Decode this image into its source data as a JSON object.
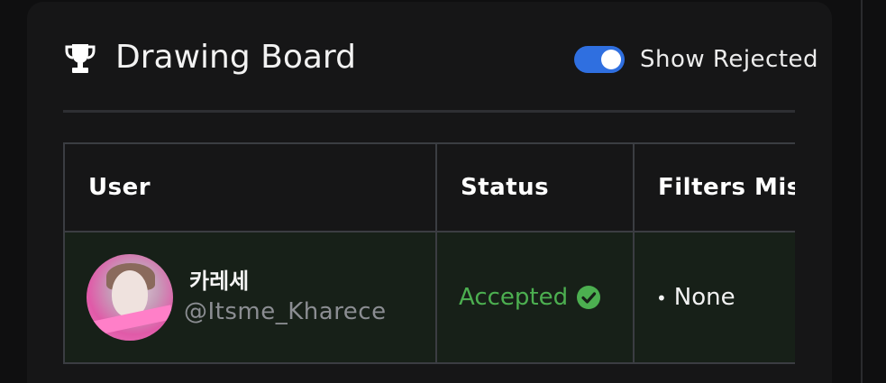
{
  "board": {
    "title": "Drawing Board",
    "icon": "trophy-icon"
  },
  "toggle": {
    "label": "Show Rejected",
    "state": "on",
    "color": "#2f6fe0"
  },
  "table": {
    "headers": [
      "User",
      "Status",
      "Filters Mis"
    ],
    "rows": [
      {
        "user_name": "카레세",
        "user_handle": "@Itsme_Kharece",
        "status": "Accepted",
        "status_color": "#4caf50",
        "filters": "None"
      }
    ]
  }
}
